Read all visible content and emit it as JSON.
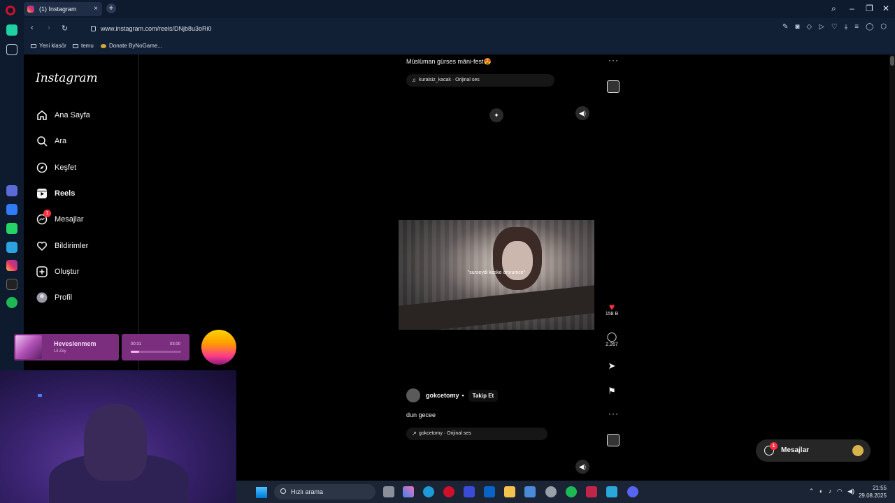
{
  "browser": {
    "tab_title": "(1) Instagram",
    "url": "www.instagram.com/reels/DNjb8u3oRi0",
    "bookmarks": [
      "Yeni klasör",
      "temu",
      "Donate ByNoGame..."
    ]
  },
  "instagram": {
    "logo": "Instagram",
    "nav": [
      {
        "label": "Ana Sayfa",
        "icon": "home-icon"
      },
      {
        "label": "Ara",
        "icon": "search-icon"
      },
      {
        "label": "Keşfet",
        "icon": "compass-icon"
      },
      {
        "label": "Reels",
        "icon": "reels-icon"
      },
      {
        "label": "Mesajlar",
        "icon": "messenger-icon",
        "badge": "1"
      },
      {
        "label": "Bildirimler",
        "icon": "heart-icon"
      },
      {
        "label": "Oluştur",
        "icon": "plus-icon"
      },
      {
        "label": "Profil",
        "icon": "avatar-icon"
      }
    ],
    "reel_prev": {
      "caption": "Müslüman gürses mâni-fest😍",
      "audio": "kuralsiz_kacak · Orijinal ses"
    },
    "reel_current": {
      "lyric_overlay": "\"surseydi keske omrumce\"",
      "likes": "158 B",
      "comments": "2.267",
      "author": "gokcetomy",
      "follow_label": "Takip Et",
      "description": "dun gecee",
      "audio": "gokcetomy · Orijinal ses"
    },
    "messages_float": {
      "label": "Mesajlar",
      "badge": "1"
    }
  },
  "music_widget": {
    "song": "Heveslenmem",
    "artist": "Lil Zey",
    "elapsed": "00:31",
    "total": "03:00",
    "progress": 0.17
  },
  "taskbar": {
    "search_placeholder": "Hızlı arama",
    "time": "21:55",
    "date": "29.08.2025"
  },
  "colors": {
    "like_red": "#ff3040",
    "widget_purple": "#7b2d7e",
    "chrome_bg": "#0e1a2e"
  }
}
